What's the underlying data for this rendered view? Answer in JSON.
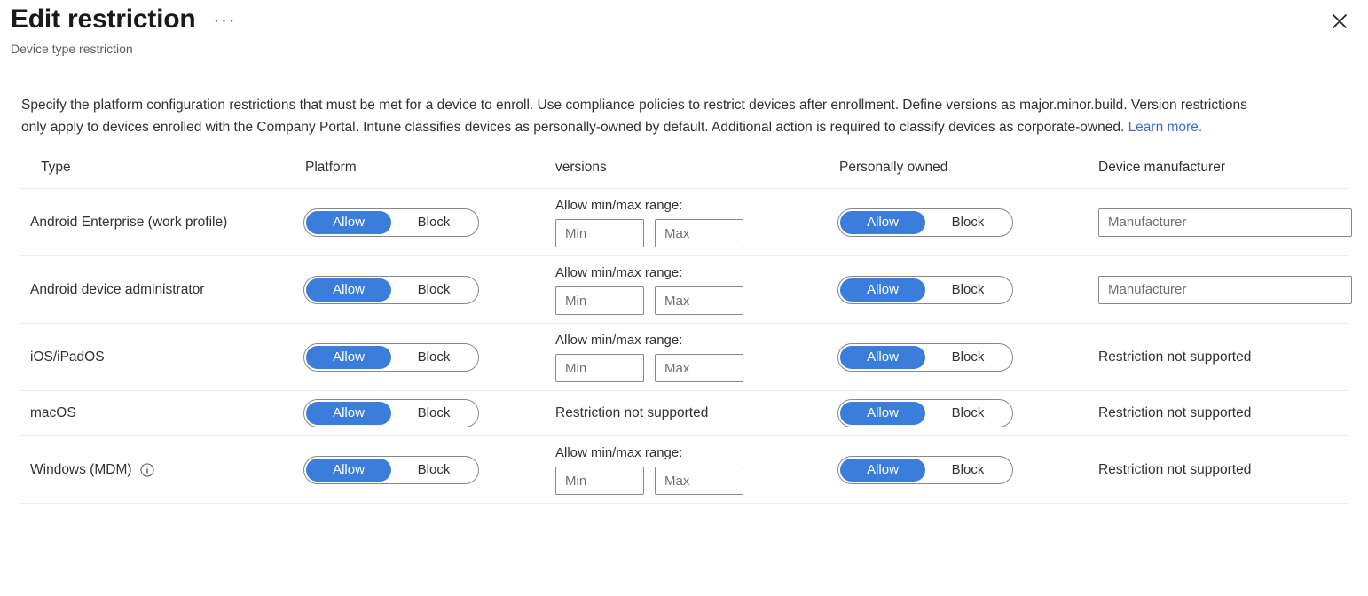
{
  "header": {
    "title": "Edit restriction",
    "subtitle": "Device type restriction",
    "overflow_label": "···",
    "close_label": "Close"
  },
  "description": {
    "text": "Specify the platform configuration restrictions that must be met for a device to enroll. Use compliance policies to restrict devices after enrollment. Define versions as major.minor.build. Version restrictions only apply to devices enrolled with the Company Portal. Intune classifies devices as personally-owned by default. Additional action is required to classify devices as corporate-owned. ",
    "link_label": "Learn more."
  },
  "table": {
    "columns": [
      "Type",
      "Platform",
      "versions",
      "Personally owned",
      "Device manufacturer"
    ],
    "labels": {
      "allow": "Allow",
      "block": "Block",
      "range_label": "Allow min/max range:",
      "min_placeholder": "Min",
      "max_placeholder": "Max",
      "manufacturer_placeholder": "Manufacturer",
      "not_supported": "Restriction not supported"
    },
    "rows": [
      {
        "type": "Android Enterprise (work profile)",
        "has_info_icon": false,
        "platform_selected": "Allow",
        "versions_mode": "range",
        "version_min": "",
        "version_max": "",
        "personally_owned_selected": "Allow",
        "manufacturer_mode": "input",
        "manufacturer_value": ""
      },
      {
        "type": "Android device administrator",
        "has_info_icon": false,
        "platform_selected": "Allow",
        "versions_mode": "range",
        "version_min": "",
        "version_max": "",
        "personally_owned_selected": "Allow",
        "manufacturer_mode": "input",
        "manufacturer_value": ""
      },
      {
        "type": "iOS/iPadOS",
        "has_info_icon": false,
        "platform_selected": "Allow",
        "versions_mode": "range",
        "version_min": "",
        "version_max": "",
        "personally_owned_selected": "Allow",
        "manufacturer_mode": "not_supported",
        "manufacturer_value": ""
      },
      {
        "type": "macOS",
        "has_info_icon": false,
        "platform_selected": "Allow",
        "versions_mode": "not_supported",
        "version_min": "",
        "version_max": "",
        "personally_owned_selected": "Allow",
        "manufacturer_mode": "not_supported",
        "manufacturer_value": ""
      },
      {
        "type": "Windows (MDM)",
        "has_info_icon": true,
        "platform_selected": "Allow",
        "versions_mode": "range",
        "version_min": "",
        "version_max": "",
        "personally_owned_selected": "Allow",
        "manufacturer_mode": "not_supported",
        "manufacturer_value": ""
      }
    ]
  },
  "colors": {
    "accent_blue": "#3a7ddb",
    "link_blue": "#3b6fcc",
    "divider": "#edebe9",
    "border": "#8a8886",
    "text": "#323130",
    "subtle_text": "#605e5c"
  }
}
